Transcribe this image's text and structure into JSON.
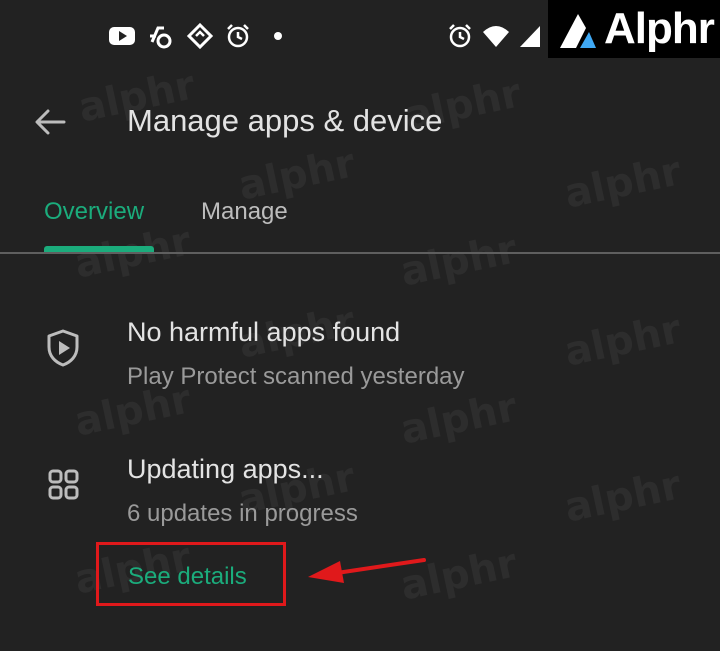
{
  "status_bar": {
    "icons": [
      "youtube-icon",
      "link-sync-icon",
      "rotate-icon",
      "alarm-icon",
      "dot-icon",
      "alarm-icon",
      "wifi-icon",
      "signal-icon"
    ]
  },
  "branding": {
    "logo_text": "Alphr",
    "watermark_text": "alphr"
  },
  "app_bar": {
    "back_icon": "arrow-back-icon",
    "title": "Manage apps & device"
  },
  "tabs": [
    {
      "label": "Overview",
      "active": true
    },
    {
      "label": "Manage",
      "active": false
    }
  ],
  "sections": [
    {
      "icon": "play-protect-shield-icon",
      "title": "No harmful apps found",
      "subtitle": "Play Protect scanned yesterday"
    },
    {
      "icon": "apps-grid-icon",
      "title": "Updating apps...",
      "subtitle": "6 updates in progress",
      "action": "See details"
    }
  ],
  "colors": {
    "background": "#222222",
    "accent": "#1bac7c",
    "annotation": "#e0191b"
  }
}
